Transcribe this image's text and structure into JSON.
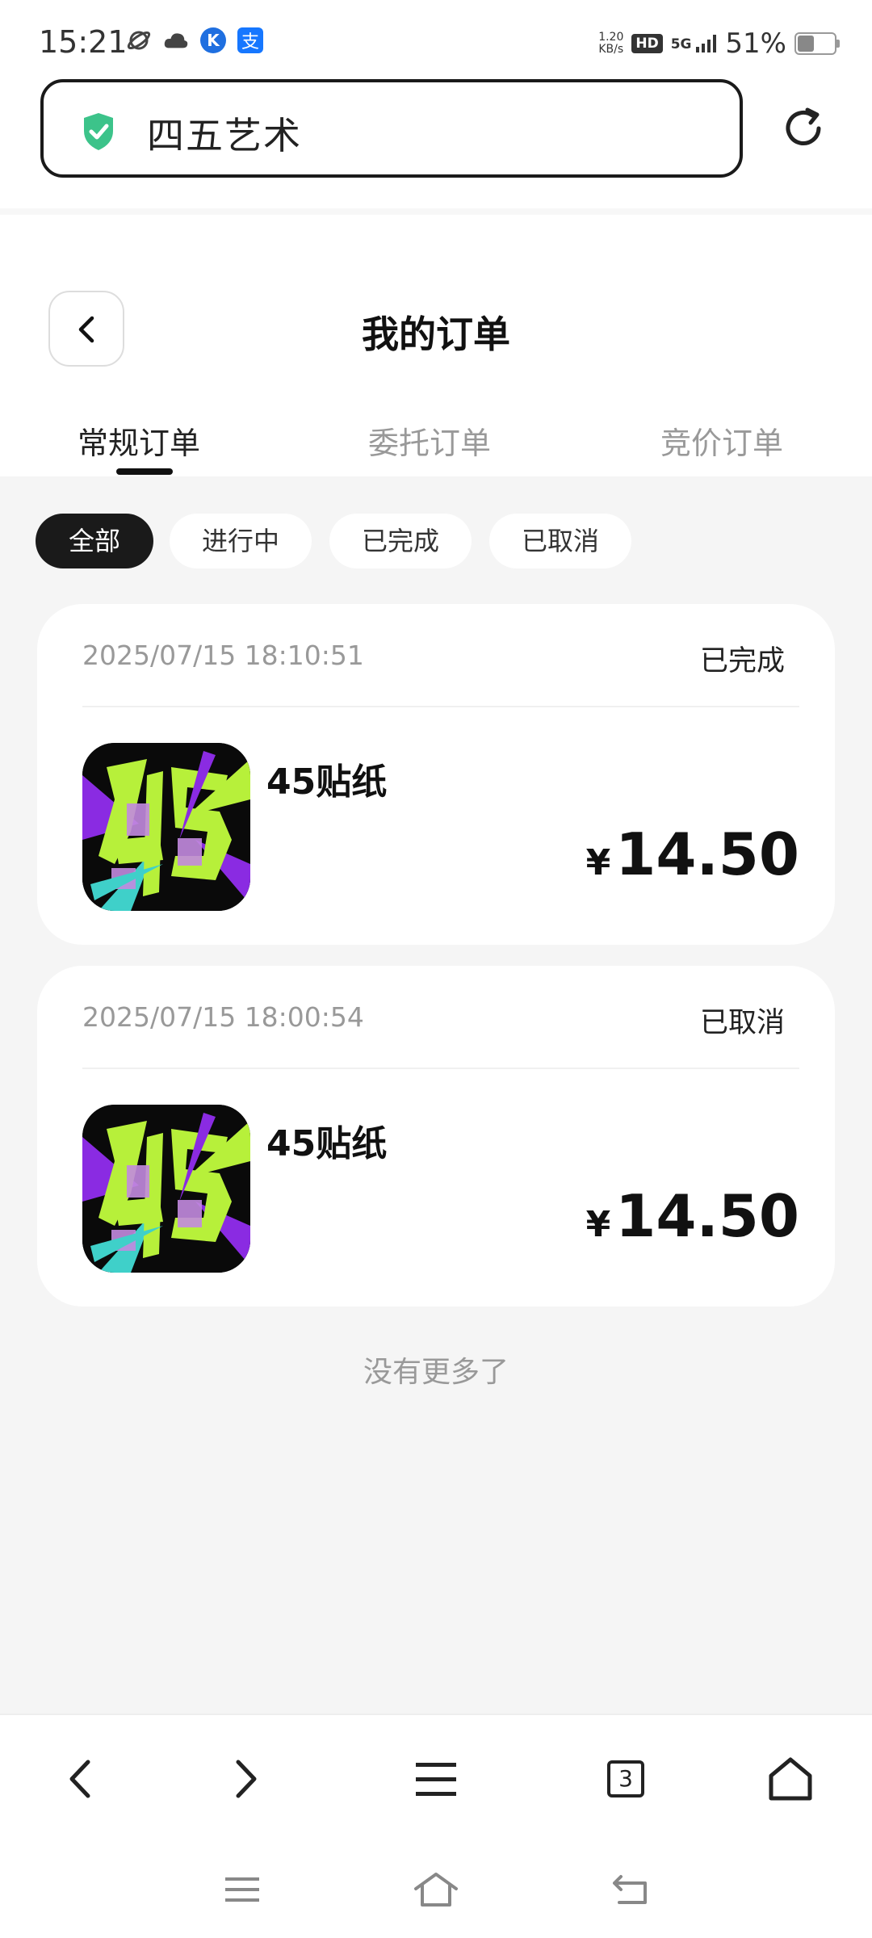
{
  "status_bar": {
    "time": "15:21",
    "net_speed_value": "1.20",
    "net_speed_unit": "KB/s",
    "hd_label": "HD",
    "network_label": "5G",
    "battery_percent": "51%",
    "battery_level": 0.51,
    "alipay_label": "支",
    "k_label": "K"
  },
  "address_bar": {
    "site_title": "四五艺术",
    "shield_color": "#3cc38a"
  },
  "page": {
    "title": "我的订单"
  },
  "tabs": [
    {
      "label": "常规订单",
      "active": true
    },
    {
      "label": "委托订单",
      "active": false
    },
    {
      "label": "竞价订单",
      "active": false
    }
  ],
  "filters": [
    {
      "label": "全部",
      "active": true
    },
    {
      "label": "进行中",
      "active": false
    },
    {
      "label": "已完成",
      "active": false
    },
    {
      "label": "已取消",
      "active": false
    }
  ],
  "orders": [
    {
      "timestamp": "2025/07/15 18:10:51",
      "status": "已完成",
      "product_name": "45贴纸",
      "currency": "¥",
      "price": "14.50"
    },
    {
      "timestamp": "2025/07/15 18:00:54",
      "status": "已取消",
      "product_name": "45贴纸",
      "currency": "¥",
      "price": "14.50"
    }
  ],
  "list_footer": "没有更多了",
  "browser_bar": {
    "tab_count": "3"
  },
  "colors": {
    "accent_dark": "#1a1a1a",
    "background_gray": "#f5f5f5",
    "thumb_green": "#b7f03a",
    "thumb_purple": "#8a2be2"
  }
}
